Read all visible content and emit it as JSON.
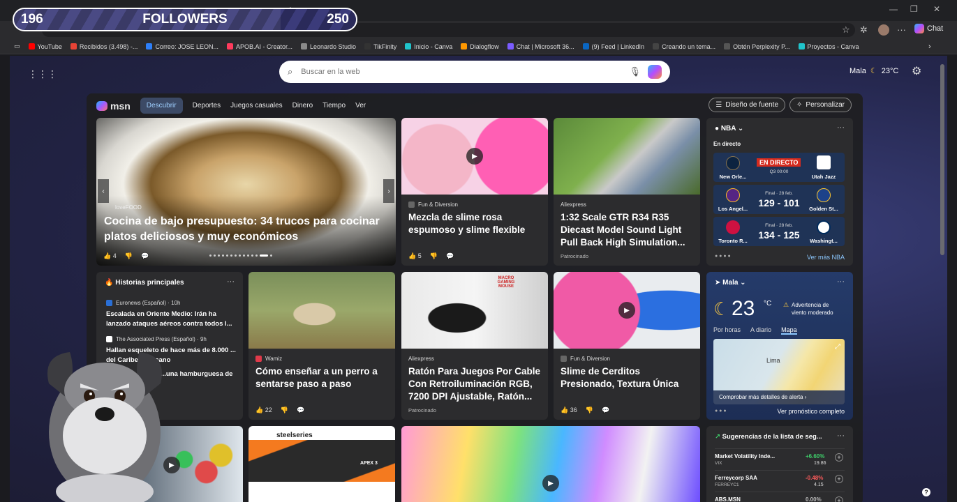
{
  "overlay": {
    "count": "196",
    "label": "FOLLOWERS",
    "goal": "250",
    "progress_fraction": 0.78
  },
  "browser": {
    "chat_label": "Chat",
    "bookmarks": [
      {
        "label": "YouTube",
        "color": "#ff0000"
      },
      {
        "label": "Recibidos (3.498) -...",
        "color": "#e84335"
      },
      {
        "label": "Correo: JOSE LEON...",
        "color": "#2d7ff9"
      },
      {
        "label": "APOB.AI - Creator...",
        "color": "#ff3b5c"
      },
      {
        "label": "Leonardo Studio",
        "color": "#8a8a8a"
      },
      {
        "label": "TikFinity",
        "color": "#333333"
      },
      {
        "label": "Inicio - Canva",
        "color": "#20c4cb"
      },
      {
        "label": "Dialogflow",
        "color": "#ff9800"
      },
      {
        "label": "Chat | Microsoft 36...",
        "color": "#7b5cff"
      },
      {
        "label": "(9) Feed | LinkedIn",
        "color": "#0a66c2"
      },
      {
        "label": "Creando un tema...",
        "color": "#444444"
      },
      {
        "label": "Obtén Perplexity P...",
        "color": "#555555"
      },
      {
        "label": "Proyectos - Canva",
        "color": "#20c4cb"
      }
    ]
  },
  "search": {
    "placeholder": "Buscar en la web"
  },
  "weather_top": {
    "place": "Mala",
    "temp": "23°C"
  },
  "nav": {
    "logo": "msn",
    "items": [
      "Descubrir",
      "Deportes",
      "Juegos casuales",
      "Dinero",
      "Tiempo",
      "Ver"
    ],
    "font_button": "Diseño de fuente",
    "personalize_button": "Personalizar"
  },
  "hero": {
    "source": "loveFOOD",
    "title": "Cocina de bajo presupuesto: 34 trucos para cocinar platos deliciosos y muy económicos",
    "likes": "4"
  },
  "cards": {
    "slime_pink": {
      "source": "Fun & Diversion",
      "title": "Mezcla de slime rosa espumoso y slime flexible",
      "likes": "5"
    },
    "gtr": {
      "source": "Aliexpress",
      "title": "1:32 Scale GTR R34 R35 Diecast Model Sound Light Pull Back High Simulation...",
      "sponsored": "Patrocinado"
    },
    "dog": {
      "source": "Wamiz",
      "title": "Cómo enseñar a un perro a sentarse paso a paso",
      "likes": "22"
    },
    "mouse": {
      "source": "Aliexpress",
      "title": "Ratón Para Juegos Por Cable Con Retroiluminación RGB, 7200 DPI Ajustable, Ratón...",
      "sponsored": "Patrocinado",
      "image_text": "MACRO GAMING MOUSE"
    },
    "slime_piggy": {
      "source": "Fun & Diversion",
      "title": "Slime de Cerditos Presionado, Textura Única",
      "likes": "36"
    }
  },
  "top_stories": {
    "header": "Historias principales",
    "items": [
      {
        "source": "Euronews (Español) · 10h",
        "title": "Escalada en Oriente Medio: Irán ha lanzado ataques aéreos contra todos l..."
      },
      {
        "source": "The Associated Press (Español) · 9h",
        "title": "Hallan esqueleto de hace más de 8.000 ... del Caribe mexicano"
      },
      {
        "source": "",
        "title": "...una hamburguesa de"
      }
    ]
  },
  "nba": {
    "header": "NBA",
    "live_label": "En directo",
    "see_more": "Ver más NBA",
    "games": [
      {
        "home": "New Orle...",
        "away": "Utah Jazz",
        "status": "EN DIRECTO",
        "meta": "Q3 00:00",
        "score": ""
      },
      {
        "home": "Los Angel...",
        "away": "Golden St...",
        "status": "",
        "meta": "Final · 28 feb.",
        "score": "129 - 101"
      },
      {
        "home": "Toronto R...",
        "away": "Washingt...",
        "status": "",
        "meta": "Final · 28 feb.",
        "score": "134 - 125"
      }
    ]
  },
  "weather": {
    "place": "Mala",
    "temp": "23",
    "unit": "°C",
    "alert": "Advertencia de viento moderado",
    "tabs": [
      "Por horas",
      "A diario",
      "Mapa"
    ],
    "map_label": "Lima",
    "alert_link": "Comprobar más detalles de alerta",
    "forecast_link": "Ver pronóstico completo"
  },
  "watchlist": {
    "header": "Sugerencias de la lista de seg...",
    "items": [
      {
        "name": "Market Volatility Inde...",
        "symbol": "VIX",
        "change": "+6.60%",
        "price": "19.86",
        "color": "#3fd16b"
      },
      {
        "name": "Ferreycorp SAA",
        "symbol": "FERREYC1",
        "change": "-0.48%",
        "price": "4.15",
        "color": "#ff5b5b"
      },
      {
        "name": "ABS.MSN",
        "symbol": "",
        "change": "0.00%",
        "price": "",
        "color": "#bbbbbb"
      }
    ]
  },
  "keyboard_brand": "steelseries",
  "keyboard_model": "APEX 3"
}
